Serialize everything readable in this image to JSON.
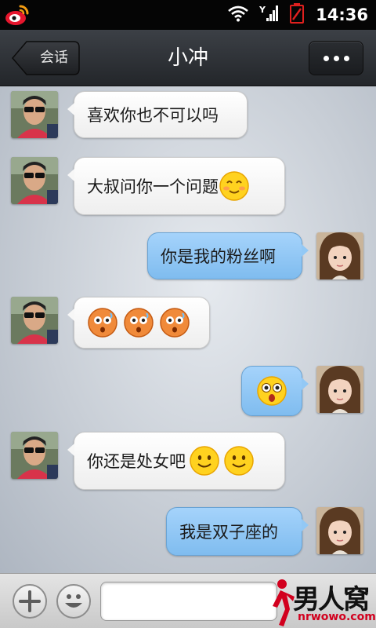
{
  "status_bar": {
    "time": "14:36"
  },
  "nav": {
    "back_label": "会话",
    "title": "小冲"
  },
  "messages": [
    {
      "side": "in",
      "text": "喜欢你也不可以吗",
      "emoji": []
    },
    {
      "side": "in",
      "text": "大叔问你一个问题",
      "emoji": [
        "blush-smile"
      ]
    },
    {
      "side": "out",
      "text": "你是我的粉丝啊",
      "emoji": []
    },
    {
      "side": "in",
      "text": "",
      "emoji": [
        "shocked-face",
        "shocked-face",
        "shocked-face"
      ]
    },
    {
      "side": "out",
      "text": "",
      "emoji": [
        "surprised-face"
      ]
    },
    {
      "side": "in",
      "text": "你还是处女吧",
      "emoji": [
        "smile-face",
        "smile-face"
      ]
    },
    {
      "side": "out",
      "text": "我是双子座的",
      "emoji": []
    }
  ],
  "input": {
    "placeholder": ""
  },
  "watermark": {
    "logo": "男人窝",
    "url": "nrwowo.com"
  },
  "colors": {
    "incoming_bubble": "#ffffff",
    "outgoing_bubble": "#8cc6f5",
    "status_bg": "#050505",
    "nav_bg": "#2e3136"
  }
}
